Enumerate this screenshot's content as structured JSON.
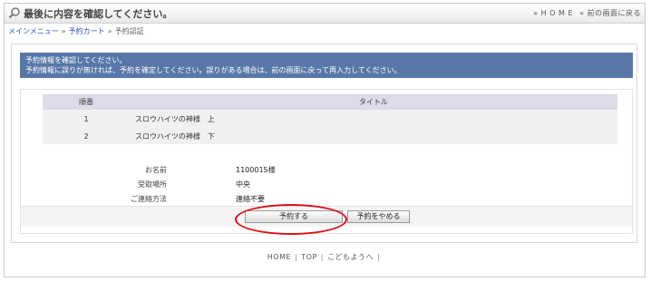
{
  "header": {
    "title": "最後に内容を確認してください。",
    "home_link": "« H O M E",
    "back_link": "« 前の画面に戻る"
  },
  "breadcrumb": {
    "items": [
      "メインメニュー",
      "予約カート",
      "予約認証"
    ],
    "separator": "»"
  },
  "notice": {
    "line1": "予約情報を確認してください。",
    "line2": "予約情報に誤りが無ければ、予約を確定してください。誤りがある場合は、前の画面に戻って再入力してください。"
  },
  "table": {
    "headers": [
      "順番",
      "タイトル"
    ],
    "rows": [
      {
        "num": "1",
        "title": "スロウハイツの神様　上"
      },
      {
        "num": "2",
        "title": "スロウハイツの神様　下"
      }
    ]
  },
  "info": {
    "name_label": "お名前",
    "name_value": "1100015様",
    "location_label": "受取場所",
    "location_value": "中央",
    "contact_label": "ご連絡方法",
    "contact_value": "連絡不要"
  },
  "actions": {
    "confirm": "予約する",
    "cancel": "予約をやめる"
  },
  "footer": {
    "home": "HOME",
    "top": "TOP",
    "kids": "こどもようへ",
    "separator": "|"
  },
  "colors": {
    "notice_bg": "#5878a8",
    "table_header_bg": "#dcdbe9",
    "highlight": "#d8121a",
    "link": "#3355aa"
  }
}
